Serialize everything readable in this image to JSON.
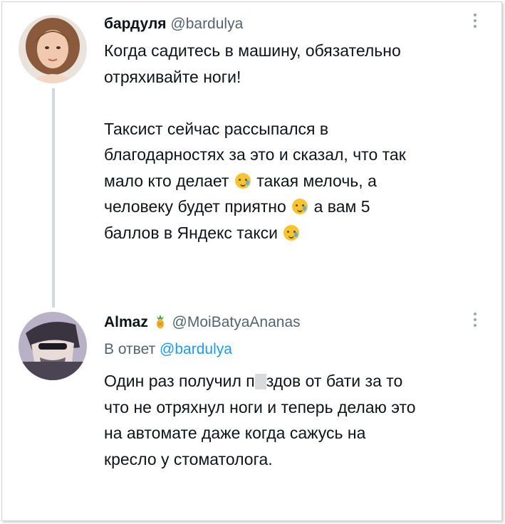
{
  "tweet1": {
    "name": "бардуля",
    "handle": "@bardulya",
    "line1": "Когда садитесь в машину, обязательно",
    "line2": "отряхивайте ноги!",
    "para2_line1": "Таксист сейчас рассыпался в",
    "para2_line2": "благодарностях за это и сказал, что так",
    "para2_line3a": "мало кто делает",
    "para2_line3b": "такая мелочь, а",
    "para2_line4a": "человеку будет приятно",
    "para2_line4b": "а вам 5",
    "para2_line5": "баллов в Яндекс такси"
  },
  "tweet2": {
    "name": "Almaz",
    "handle": "@MoiBatyaAnanas",
    "reply_prefix": "В ответ",
    "reply_handle": "@bardulya",
    "line1a": "Один раз получил п",
    "line1b": "здов от бати за то",
    "line2": "что не отряхнул ноги и теперь делаю это",
    "line3": "на автомате даже когда сажусь на",
    "line4": "кресло у стоматолога."
  },
  "icons": {
    "more": "more-vertical-icon",
    "emoji": "smiling-face-with-tear-icon",
    "pineapple": "pineapple-icon"
  },
  "colors": {
    "link": "#1d9bf0",
    "secondary_text": "#536471",
    "thread_line": "#cfd9de"
  }
}
